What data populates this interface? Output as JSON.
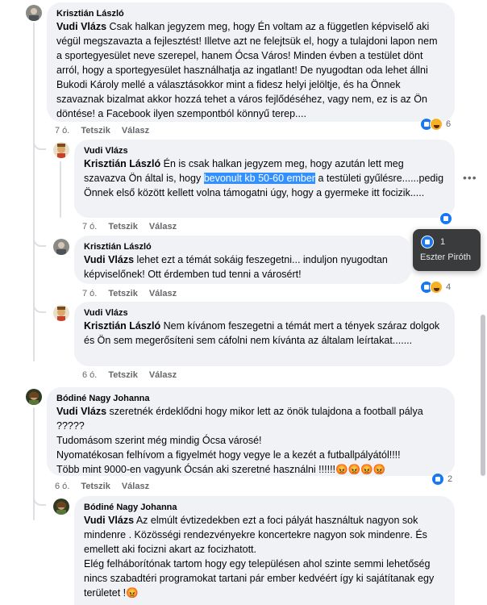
{
  "comments": [
    {
      "author": "Krisztián László",
      "tag": "Vudi Vlázs",
      "text": " Csak halkan jegyzem meg, hogy Én voltam az a független képviselő aki végül megszavazta a fejlesztést! Illetve azt ne felejtsük el, hogy a tulajdoni lapon nem a sportegyesület neve szerepel, hanem Ócsa Város! Minden évben a testület dönt arról, hogy a sportegyesület használhatja az ingatlant! De nyugodtan oda lehet állni Bukodi Károly mellé a választásokkor mint a fidesz helyi jelöltje, és ha Önnek szavaznak bizalmat akkor hozzá tehet a város fejlődéséhez, vagy nem, ez is az Ön döntése! a Facebook ilyen szempontból könnyű terep....",
      "time": "7 ó.",
      "like_label": "Tetszik",
      "reply_label": "Válasz",
      "reaction_count": "6"
    },
    {
      "author": "Vudi Vlázs",
      "tag": "Krisztián László",
      "text_before": " Én is csak halkan jegyzem meg, hogy azután lett meg szavazva Ön által is, hogy ",
      "highlight": "bevonult kb 50-60 ember",
      "text_after": " a testületi gyűlésre......pedig Önnek első között kellett volna támogatni úgy, hogy a gyermeke itt focizik.....",
      "time": "7 ó.",
      "like_label": "Tetszik",
      "reply_label": "Válasz"
    },
    {
      "author": "Krisztián László",
      "tag": "Vudi Vlázs",
      "text": " lehet ezt a témát sokáig feszegetni... induljon nyugodtan képviselőnek! Ott érdemben tud tenni a városért!",
      "time": "7 ó.",
      "like_label": "Tetszik",
      "reply_label": "Válasz",
      "reaction_count": "4"
    },
    {
      "author": "Vudi Vlázs",
      "tag": "Krisztián László",
      "text": " Nem kívánom feszegetni a témát mert a tények száraz dolgok és Ön sem megerősíteni sem cáfolni nem kívánta az általam leírtakat.......",
      "time": "6 ó.",
      "like_label": "Tetszik",
      "reply_label": "Válasz"
    },
    {
      "author": "Bódiné Nagy Johanna",
      "tag": "Vudi Vlázs",
      "lines": [
        " szeretnék érdeklődni hogy mikor lett az önök tulajdona a football pálya ?????",
        "Tudomásom szerint még mindig Ócsa városé!",
        "Nyomatékosan felhívom a figyelmét hogy vegye le a kezét a futballpályától!!!!",
        "Több mint 9000-en vagyunk Ócsán aki szeretné használni !!!!!!😡😡😡😡"
      ],
      "time": "6 ó.",
      "like_label": "Tetszik",
      "reply_label": "Válasz",
      "reaction_count": "2"
    },
    {
      "author": "Bódiné Nagy Johanna",
      "tag": "Vudi Vlázs",
      "lines": [
        " Az elmúlt évtizedekben ezt a foci pályát használtuk nagyon sok mindenre . Közösségi rendezvényekre koncertekre nagyon sok mindenre. És emellett aki focizni akart az focizhatott.",
        "Elég felháborítónak tartom hogy egy településen ahol szinte semmi lehetőség nincs szabadtéri programokat tartani pár ember kedvéért így ki sajátítanak egy területet !😡"
      ]
    }
  ],
  "tooltip": {
    "count": "1",
    "name": "Eszter Piróth"
  },
  "more_icon": "more-options-icon",
  "colors": {
    "bubble": "#f0f2f5",
    "like": "#1877f2",
    "highlight": "#3390ff"
  }
}
